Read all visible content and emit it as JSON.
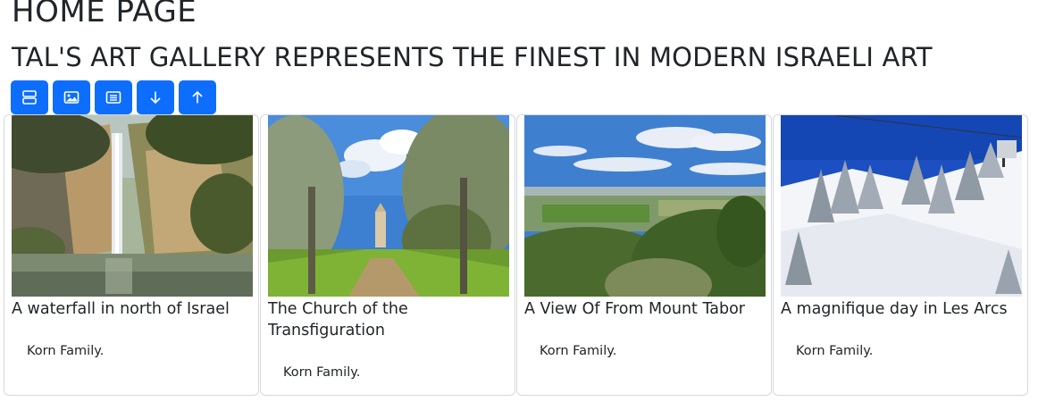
{
  "header": {
    "title": "HOME PAGE",
    "subtitle": "TAL'S ART GALLERY REPRESENTS THE FINEST IN MODERN ISRAELI ART"
  },
  "toolbar": {
    "accent_color": "#0d6efd",
    "buttons": [
      {
        "icon": "rows-icon"
      },
      {
        "icon": "image-icon"
      },
      {
        "icon": "list-icon"
      },
      {
        "icon": "arrow-down-icon"
      },
      {
        "icon": "arrow-up-icon"
      }
    ]
  },
  "cards": [
    {
      "title": "A waterfall in north of Israel",
      "text": "Korn Family.",
      "image": "waterfall"
    },
    {
      "title": "The Church of the Transfiguration",
      "text": "Korn Family.",
      "image": "church"
    },
    {
      "title": "A View Of From Mount Tabor",
      "text": "Korn Family.",
      "image": "valley-view"
    },
    {
      "title": "A magnifique day in Les Arcs",
      "text": "Korn Family.",
      "image": "snowy-slope"
    }
  ]
}
